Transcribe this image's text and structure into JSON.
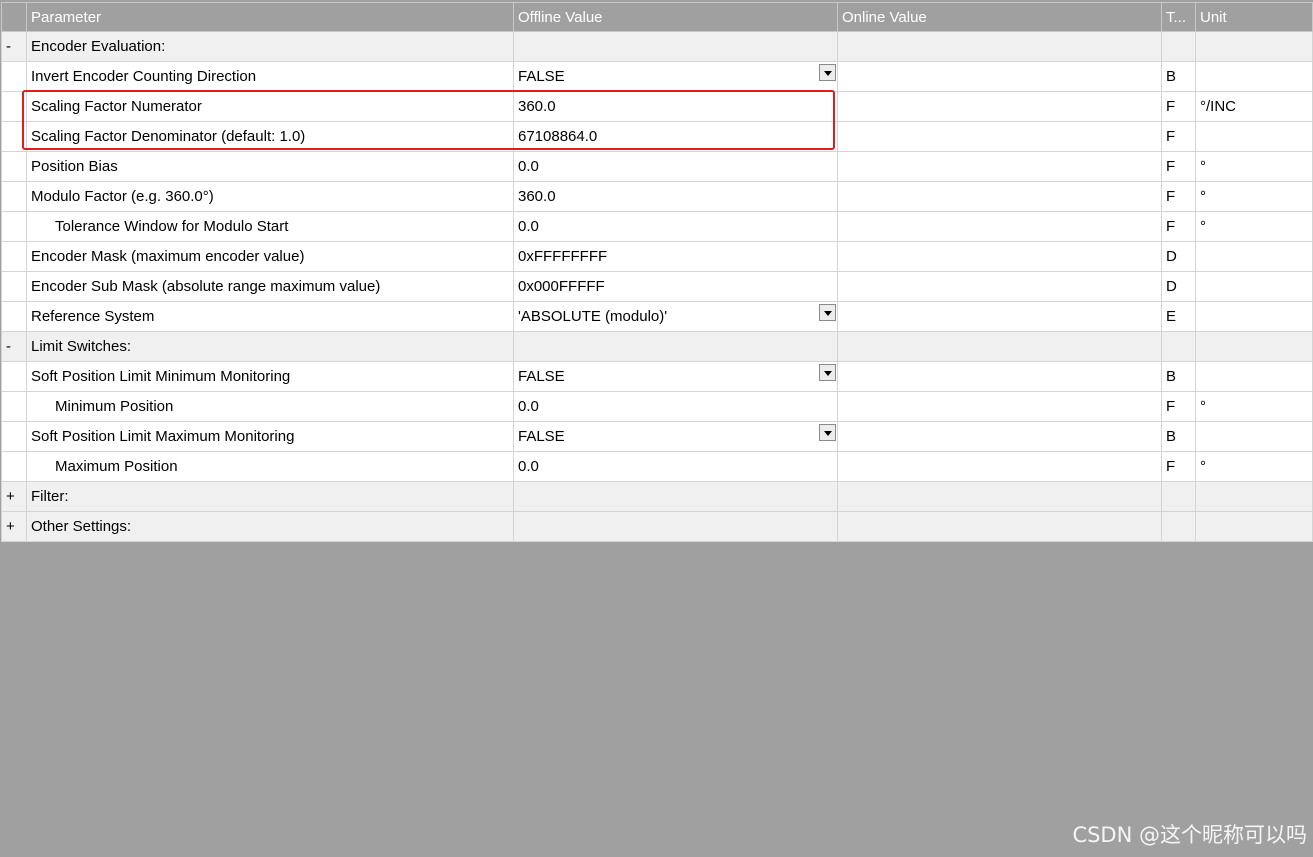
{
  "header": {
    "expander": "",
    "parameter": "Parameter",
    "offline": "Offline Value",
    "online": "Online Value",
    "type": "T...",
    "unit": "Unit"
  },
  "rows": [
    {
      "exp": "-",
      "name": "Encoder Evaluation:",
      "offline": "",
      "online": "",
      "type": "",
      "unit": ""
    },
    {
      "exp": "",
      "name": "Invert Encoder Counting Direction",
      "offline": "FALSE",
      "online": "",
      "type": "B",
      "unit": ""
    },
    {
      "exp": "",
      "name": "Scaling Factor Numerator",
      "offline": "360.0",
      "online": "",
      "type": "F",
      "unit": "°/INC"
    },
    {
      "exp": "",
      "name": "Scaling Factor Denominator (default: 1.0)",
      "offline": "67108864.0",
      "online": "",
      "type": "F",
      "unit": ""
    },
    {
      "exp": "",
      "name": "Position Bias",
      "offline": "0.0",
      "online": "",
      "type": "F",
      "unit": "°"
    },
    {
      "exp": "",
      "name": "Modulo Factor (e.g. 360.0°)",
      "offline": "360.0",
      "online": "",
      "type": "F",
      "unit": "°"
    },
    {
      "exp": "",
      "name": "Tolerance Window for Modulo Start",
      "offline": "0.0",
      "online": "",
      "type": "F",
      "unit": "°"
    },
    {
      "exp": "",
      "name": "Encoder Mask (maximum encoder value)",
      "offline": "0xFFFFFFFF",
      "online": "",
      "type": "D",
      "unit": ""
    },
    {
      "exp": "",
      "name": "Encoder Sub Mask (absolute range maximum value)",
      "offline": "0x000FFFFF",
      "online": "",
      "type": "D",
      "unit": ""
    },
    {
      "exp": "",
      "name": "Reference System",
      "offline": "'ABSOLUTE (modulo)'",
      "online": "",
      "type": "E",
      "unit": ""
    },
    {
      "exp": "-",
      "name": "Limit Switches:",
      "offline": "",
      "online": "",
      "type": "",
      "unit": ""
    },
    {
      "exp": "",
      "name": "Soft Position Limit Minimum Monitoring",
      "offline": "FALSE",
      "online": "",
      "type": "B",
      "unit": ""
    },
    {
      "exp": "",
      "name": "Minimum Position",
      "offline": "0.0",
      "online": "",
      "type": "F",
      "unit": "°"
    },
    {
      "exp": "",
      "name": "Soft Position Limit Maximum Monitoring",
      "offline": "FALSE",
      "online": "",
      "type": "B",
      "unit": ""
    },
    {
      "exp": "",
      "name": "Maximum Position",
      "offline": "0.0",
      "online": "",
      "type": "F",
      "unit": "°"
    },
    {
      "exp": "+",
      "name": "Filter:",
      "offline": "",
      "online": "",
      "type": "",
      "unit": ""
    },
    {
      "exp": "+",
      "name": "Other Settings:",
      "offline": "",
      "online": "",
      "type": "",
      "unit": ""
    }
  ],
  "watermark": "CSDN @这个昵称可以吗"
}
